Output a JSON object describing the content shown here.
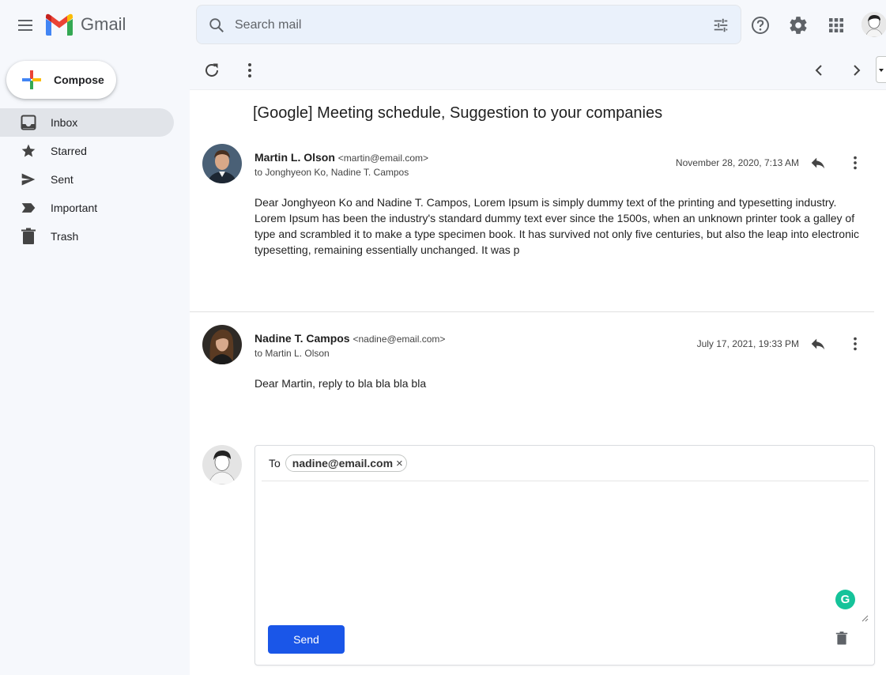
{
  "app": {
    "name": "Gmail"
  },
  "search": {
    "placeholder": "Search mail"
  },
  "sidebar": {
    "compose_label": "Compose",
    "items": [
      {
        "label": "Inbox",
        "icon": "inbox-icon",
        "active": true
      },
      {
        "label": "Starred",
        "icon": "star-icon",
        "active": false
      },
      {
        "label": "Sent",
        "icon": "send-icon",
        "active": false
      },
      {
        "label": "Important",
        "icon": "important-icon",
        "active": false
      },
      {
        "label": "Trash",
        "icon": "trash-icon",
        "active": false
      }
    ]
  },
  "thread": {
    "subject": "[Google] Meeting schedule, Suggestion to your companies",
    "messages": [
      {
        "sender_name": "Martin L. Olson",
        "sender_email": "<martin@email.com>",
        "to": "to Jonghyeon Ko, Nadine T. Campos",
        "date": "November 28, 2020, 7:13 AM",
        "body": "Dear Jonghyeon Ko and Nadine T. Campos, Lorem Ipsum is simply dummy text of the printing and typesetting industry. Lorem Ipsum has been the industry's standard dummy text ever since the 1500s, when an unknown printer took a galley of type and scrambled it to make a type specimen book. It has survived not only five centuries, but also the leap into electronic typesetting, remaining essentially unchanged. It was p"
      },
      {
        "sender_name": "Nadine T. Campos",
        "sender_email": "<nadine@email.com>",
        "to": "to Martin L. Olson",
        "date": "July 17, 2021, 19:33 PM",
        "body": "Dear Martin, reply to bla bla bla bla"
      }
    ]
  },
  "reply": {
    "to_label": "To",
    "recipient": "nadine@email.com",
    "remove_symbol": "×",
    "send_label": "Send",
    "grammarly_letter": "G"
  },
  "colors": {
    "accent": "#1a56e8",
    "active_nav": "#e1e4e9",
    "grammarly": "#15c39a"
  }
}
